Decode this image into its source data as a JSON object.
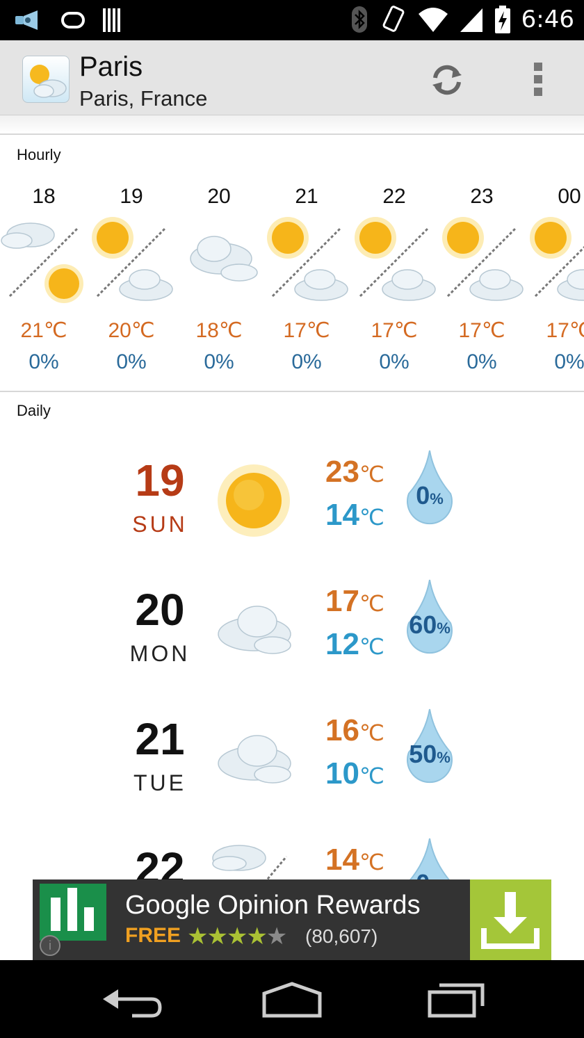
{
  "status_bar": {
    "time": "6:46"
  },
  "header": {
    "title": "Paris",
    "subtitle": "Paris, France"
  },
  "hourly": {
    "label": "Hourly",
    "items": [
      {
        "time": "18",
        "icon": "cloud-to-sun-icon",
        "temp": "21℃",
        "precip": "0%"
      },
      {
        "time": "19",
        "icon": "sun-to-cloud-icon",
        "temp": "20℃",
        "precip": "0%"
      },
      {
        "time": "20",
        "icon": "cloudy-icon",
        "temp": "18℃",
        "precip": "0%"
      },
      {
        "time": "21",
        "icon": "sun-to-cloud-icon",
        "temp": "17℃",
        "precip": "0%"
      },
      {
        "time": "22",
        "icon": "sun-to-cloud-icon",
        "temp": "17℃",
        "precip": "0%"
      },
      {
        "time": "23",
        "icon": "sun-to-cloud-icon",
        "temp": "17℃",
        "precip": "0%"
      },
      {
        "time": "00",
        "icon": "sun-to-cloud-icon",
        "temp": "17℃",
        "precip": "0%"
      }
    ]
  },
  "daily": {
    "label": "Daily",
    "items": [
      {
        "day": "19",
        "weekday": "SUN",
        "icon": "sunny-icon",
        "high": "23",
        "low": "14",
        "unit": "℃",
        "precip": "0",
        "precip_unit": "%",
        "today": true
      },
      {
        "day": "20",
        "weekday": "MON",
        "icon": "cloudy-icon",
        "high": "17",
        "low": "12",
        "unit": "℃",
        "precip": "60",
        "precip_unit": "%"
      },
      {
        "day": "21",
        "weekday": "TUE",
        "icon": "cloudy-icon",
        "high": "16",
        "low": "10",
        "unit": "℃",
        "precip": "50",
        "precip_unit": "%"
      },
      {
        "day": "22",
        "weekday": "",
        "icon": "cloud-to-sun-icon",
        "high": "14",
        "low": "",
        "unit": "℃",
        "precip": "0",
        "precip_unit": "%"
      }
    ]
  },
  "ad": {
    "title": "Google Opinion Rewards",
    "price": "FREE",
    "rating_count": "(80,607)",
    "rating": 4.5,
    "colors": {
      "background": "#333333",
      "download": "#a4c639",
      "price": "#f0a021"
    }
  },
  "colors": {
    "high_temp": "#d47224",
    "low_temp": "#2c98c9",
    "today": "#b63b16",
    "precip": "#1f5a8e"
  }
}
